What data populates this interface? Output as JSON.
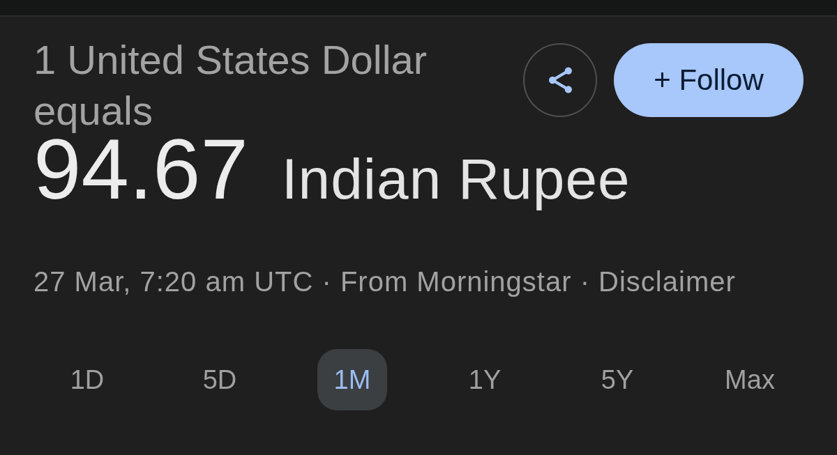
{
  "heading": "1 United States Dollar equals",
  "actions": [
    {
      "kind": "share"
    },
    {
      "kind": "follow",
      "label": "+ Follow"
    }
  ],
  "rate": {
    "value": "94.67",
    "currency": "Indian Rupee"
  },
  "meta": {
    "text": "27 Mar, 7:20 am UTC · From Morningstar ·",
    "link": "Disclaimer"
  },
  "ranges": [
    {
      "label": "1D",
      "selected": false
    },
    {
      "label": "5D",
      "selected": false
    },
    {
      "label": "1M",
      "selected": true
    },
    {
      "label": "1Y",
      "selected": false
    },
    {
      "label": "5Y",
      "selected": false
    },
    {
      "label": "Max",
      "selected": false
    }
  ]
}
